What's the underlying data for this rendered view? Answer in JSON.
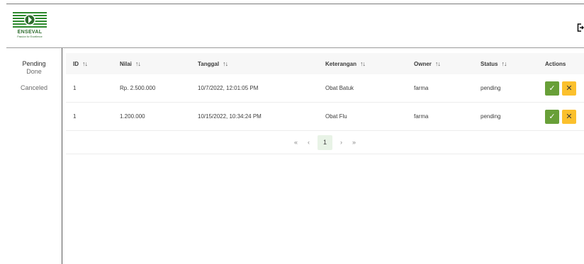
{
  "brand": {
    "name": "ENSEVAL",
    "tagline": "Passion for Excellence",
    "accent": "#2e6d2e"
  },
  "sidebar": {
    "items": [
      "Pending",
      "Done",
      "Canceled"
    ]
  },
  "table": {
    "columns": [
      "ID",
      "Nilai",
      "Tanggal",
      "Keterangan",
      "Owner",
      "Status",
      "Actions"
    ],
    "rows": [
      {
        "id": "1",
        "nilai": "Rp. 2.500.000",
        "tanggal": "10/7/2022, 12:01:05 PM",
        "keterangan": "Obat Batuk",
        "owner": "farma",
        "status": "pending"
      },
      {
        "id": "1",
        "nilai": "1.200.000",
        "tanggal": "10/15/2022, 10:34:24 PM",
        "keterangan": "Obat Flu",
        "owner": "farma",
        "status": "pending"
      }
    ]
  },
  "pagination": {
    "first": "«",
    "prev": "‹",
    "current": "1",
    "next": "›",
    "last": "»"
  },
  "icons": {
    "approve": "check-icon",
    "reject": "close-icon",
    "sort": "sort-icon",
    "logout": "logout-icon"
  },
  "colors": {
    "approve": "#689f38",
    "reject": "#fbc02d",
    "current_page": "#e8f3e6"
  }
}
